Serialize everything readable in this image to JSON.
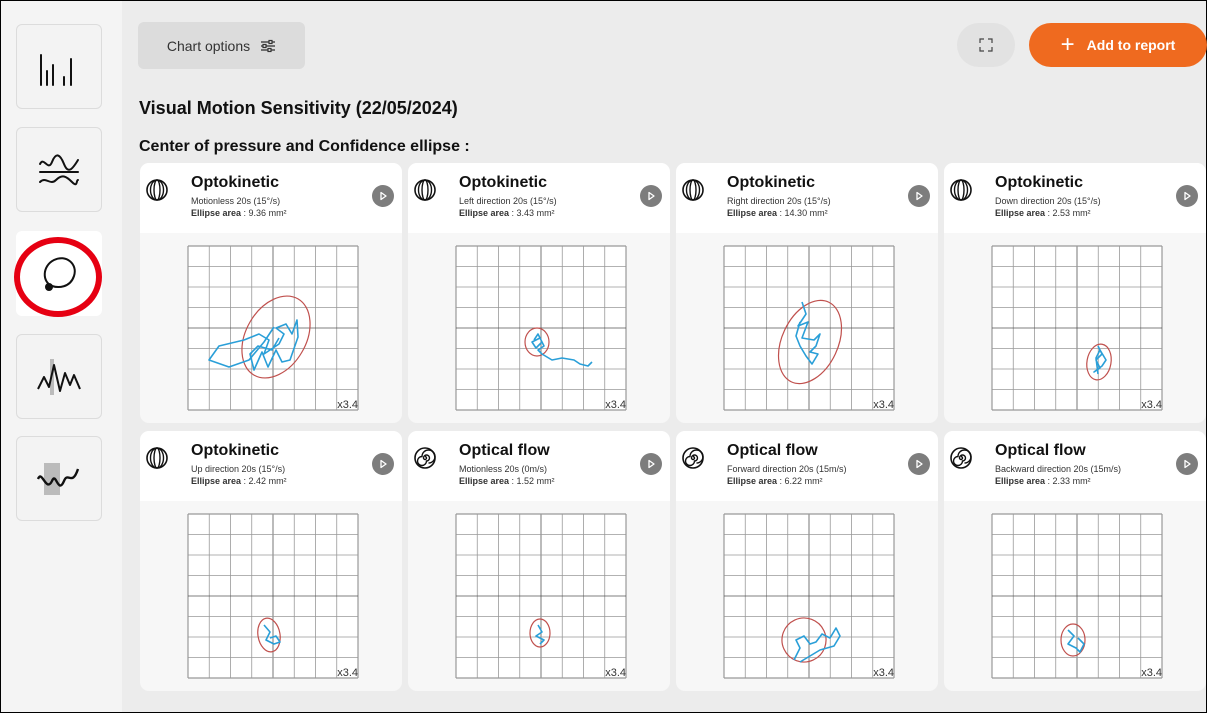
{
  "toolbar": {
    "chart_options_label": "Chart options",
    "add_to_report_label": "Add to report"
  },
  "page": {
    "title": "Visual Motion Sensitivity (22/05/2024)",
    "section_title": "Center of pressure and Confidence ellipse :"
  },
  "sidebar": {
    "items": [
      {
        "icon": "bar-chart-icon",
        "active": false
      },
      {
        "icon": "waveform-stack-icon",
        "active": false
      },
      {
        "icon": "stabilogram-icon",
        "active": true
      },
      {
        "icon": "signal-wave-icon",
        "active": false
      },
      {
        "icon": "spectrum-wave-icon",
        "active": false
      }
    ]
  },
  "cards": [
    {
      "title": "Optokinetic",
      "icon": "optokinetic-drum-icon",
      "subtitle": "Motionless 20s (15°/s)",
      "area_label": "Ellipse area",
      "area_value": " : 9.36 mm²",
      "scale": "x3.4"
    },
    {
      "title": "Optokinetic",
      "icon": "optokinetic-drum-icon",
      "subtitle": "Left direction 20s (15°/s)",
      "area_label": "Ellipse area",
      "area_value": " : 3.43 mm²",
      "scale": "x3.4"
    },
    {
      "title": "Optokinetic",
      "icon": "optokinetic-drum-icon",
      "subtitle": "Right direction 20s (15°/s)",
      "area_label": "Ellipse area",
      "area_value": " : 14.30 mm²",
      "scale": "x3.4"
    },
    {
      "title": "Optokinetic",
      "icon": "optokinetic-drum-icon",
      "subtitle": "Down direction 20s (15°/s)",
      "area_label": "Ellipse area",
      "area_value": " : 2.53 mm²",
      "scale": "x3.4"
    },
    {
      "title": "Optokinetic",
      "icon": "optokinetic-drum-icon",
      "subtitle": "Up direction 20s (15°/s)",
      "area_label": "Ellipse area",
      "area_value": " : 2.42 mm²",
      "scale": "x3.4"
    },
    {
      "title": "Optical flow",
      "icon": "optical-flow-spiral-icon",
      "subtitle": "Motionless 20s (0m/s)",
      "area_label": "Ellipse area",
      "area_value": " : 1.52 mm²",
      "scale": "x3.4"
    },
    {
      "title": "Optical flow",
      "icon": "optical-flow-spiral-icon",
      "subtitle": "Forward direction 20s (15m/s)",
      "area_label": "Ellipse area",
      "area_value": " : 6.22 mm²",
      "scale": "x3.4"
    },
    {
      "title": "Optical flow",
      "icon": "optical-flow-spiral-icon",
      "subtitle": "Backward direction 20s (15m/s)",
      "area_label": "Ellipse area",
      "area_value": " : 2.33 mm²",
      "scale": "x3.4"
    }
  ],
  "colors": {
    "accent": "#ef6a1f",
    "trace": "#2a9fd8",
    "ellipse": "#c0504d",
    "highlight_ring": "#e60012"
  }
}
